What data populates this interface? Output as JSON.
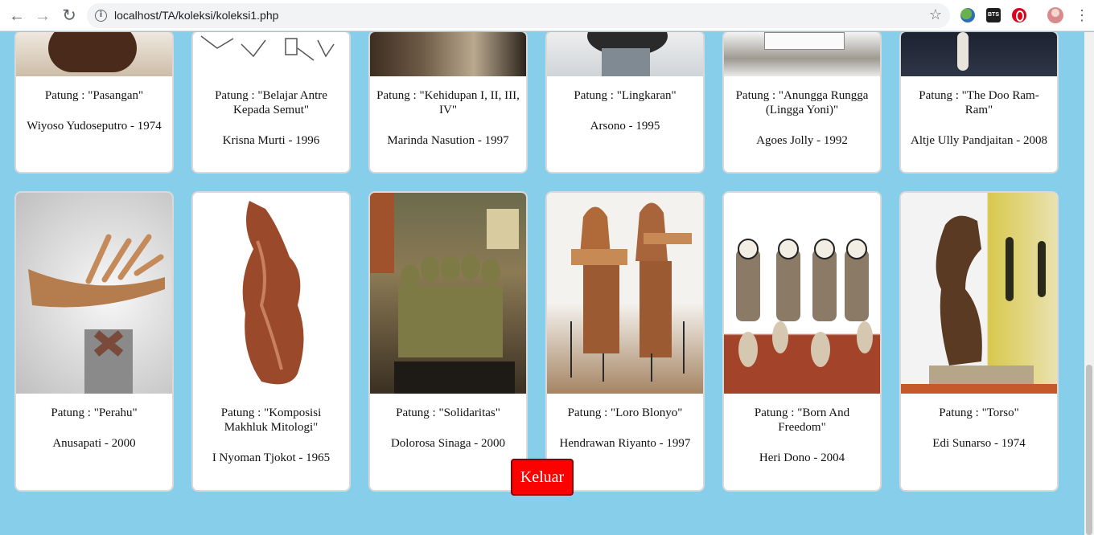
{
  "browser": {
    "url": "localhost/TA/koleksi/koleksi1.php",
    "ext2_label": "BTS"
  },
  "collection": {
    "row1": [
      {
        "title": "Patung : \"Pasangan\"",
        "artist": "Wiyoso Yudoseputro - 1974"
      },
      {
        "title": "Patung : \"Belajar Antre Kepada Semut\"",
        "artist": "Krisna Murti - 1996"
      },
      {
        "title": "Patung : \"Kehidupan I, II, III, IV\"",
        "artist": "Marinda Nasution - 1997"
      },
      {
        "title": "Patung : \"Lingkaran\"",
        "artist": "Arsono - 1995"
      },
      {
        "title": "Patung : \"Anunggа Rungga (Lingga Yoni)\"",
        "artist": "Agoes Jolly - 1992"
      },
      {
        "title": "Patung : \"The Doo Ram-Ram\"",
        "artist": "Altje Ully Pandjaitan - 2008"
      }
    ],
    "row2": [
      {
        "title": "Patung : \"Perahu\"",
        "artist": "Anusapati - 2000"
      },
      {
        "title": "Patung : \"Komposisi Makhluk Mitologi\"",
        "artist": "I Nyoman Tjokot - 1965"
      },
      {
        "title": "Patung : \"Solidaritas\"",
        "artist": "Dolorosa Sinaga - 2000"
      },
      {
        "title": "Patung : \"Loro Blonyo\"",
        "artist": "Hendrawan Riyanto - 1997"
      },
      {
        "title": "Patung : \"Born And Freedom\"",
        "artist": "Heri Dono - 2004"
      },
      {
        "title": "Patung : \"Torso\"",
        "artist": "Edi Sunarso - 1974"
      }
    ]
  },
  "logout_label": "Keluar"
}
